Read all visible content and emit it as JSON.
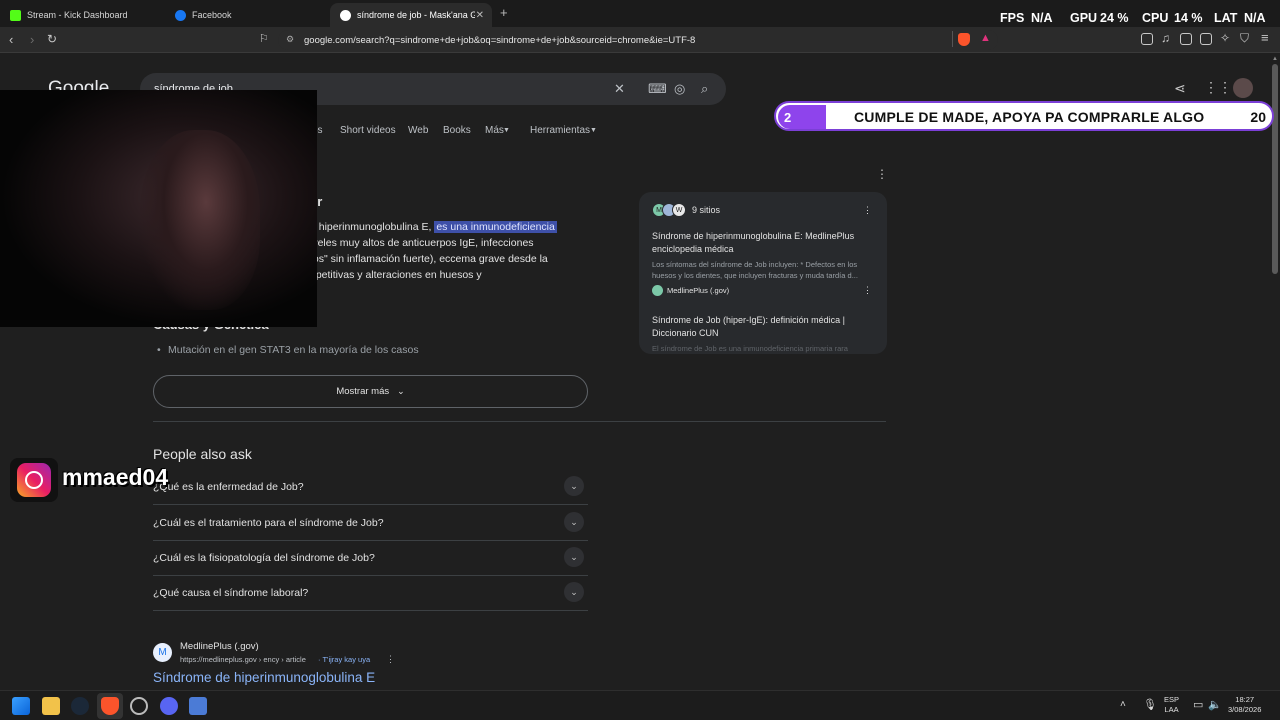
{
  "tabs": [
    {
      "title": "Stream - Kick Dashboard",
      "favicon_color": "#53fc18"
    },
    {
      "title": "Facebook",
      "favicon_color": "#1877f2"
    },
    {
      "title": "síndrome de job - Mask'ana Goo",
      "favicon_color": "#ffffff"
    }
  ],
  "new_tab_label": "+",
  "perf_overlay": {
    "fps_label": "FPS",
    "fps_value": "N/A",
    "gpu_label": "GPU",
    "gpu_value": "24 %",
    "cpu_label": "CPU",
    "cpu_value": "14 %",
    "lat_label": "LAT",
    "lat_value": "N/A"
  },
  "url": "google.com/search?q=sindrome+de+job&oq=sindrome+de+job&sourceid=chrome&ie=UTF-8",
  "google": {
    "logo_text": "Google",
    "search_value": "síndrome de job",
    "filters": [
      "os",
      "Short videos",
      "Web",
      "Books",
      "Más",
      "Herramientas"
    ]
  },
  "ai_overview": {
    "heading_fragment": "er",
    "line1_prefix": "e hiperinmunoglobulina E, ",
    "line1_highlight": "es una inmunodeficiencia",
    "line2": "iveles muy altos de anticuerpos IgE, infecciones",
    "line3": "íos\" sin inflamación fuerte), eccema grave desde la",
    "line4": "epetitivas y alteraciones en huesos y",
    "section_heading": "Causas y Genética",
    "bullet1": "Mutación en el gen STAT3 en la mayoría de los casos",
    "show_more": "Mostrar más"
  },
  "sites_card": {
    "count_label": "9 sitios",
    "item1_title": "Síndrome de hiperinmunoglobulina E: MedlinePlus enciclopedia médica",
    "item1_snippet": "Los síntomas del síndrome de Job incluyen: * Defectos en los huesos y los dientes, que incluyen fracturas y muda tardía d...",
    "item1_source": "MedlinePlus (.gov)",
    "item2_title": "Síndrome de Job (hiper-IgE): definición médica | Diccionario CUN",
    "item2_snippet": "El síndrome de Job es una inmunodeficiencia primaria rara"
  },
  "people_also_ask": {
    "title": "People also ask",
    "questions": [
      "¿Qué es la enfermedad de Job?",
      "¿Cuál es el tratamiento para el síndrome de Job?",
      "¿Cuál es la fisiopatología del síndrome de Job?",
      "¿Qué causa el síndrome laboral?"
    ]
  },
  "result": {
    "site_name": "MedlinePlus (.gov)",
    "breadcrumb": "https://medlineplus.gov › ency › article",
    "translate_link": "T'ijray kay uya",
    "title": "Síndrome de hiperinmunoglobulina E"
  },
  "stream_banner": {
    "badge": "2",
    "text": "CUMPLE DE MADE, APOYA PA COMPRARLE ALGO",
    "number": "20"
  },
  "instagram": {
    "handle": "mmaed04"
  },
  "taskbar": {
    "lang1": "ESP",
    "lang2": "LAA",
    "time": "18:27",
    "date": "3/08/2026"
  }
}
